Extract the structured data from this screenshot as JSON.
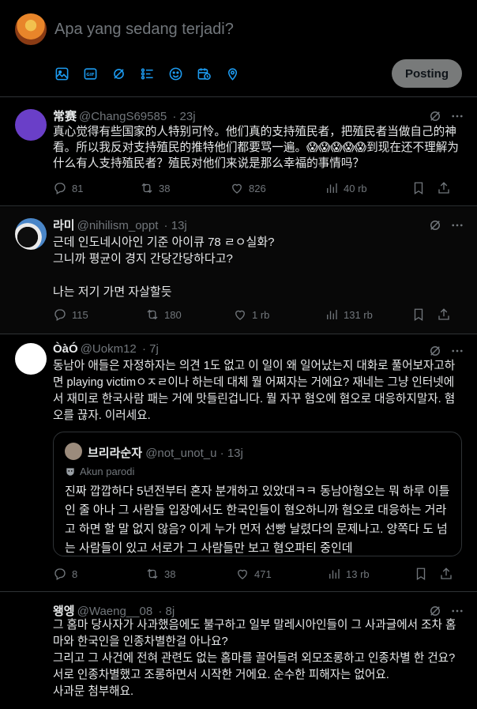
{
  "composer": {
    "placeholder": "Apa yang sedang terjadi?",
    "tools": [
      "image-icon",
      "gif-icon",
      "grok-icon",
      "poll-icon",
      "emoji-icon",
      "schedule-icon",
      "location-icon"
    ],
    "post_label": "Posting"
  },
  "tweets": [
    {
      "name": "常赛",
      "handle": "@ChangS69585",
      "time": "23j",
      "text": "真心觉得有些国家的人特别可怜。他们真的支持殖民者，把殖民者当做自己的神看。所以我反对支持殖民的推特他们都要骂一遍。😱😱😱😱😱到现在还不理解为什么有人支持殖民者？殖民对他们来说是那么幸福的事情吗？",
      "replies": "81",
      "reposts": "38",
      "likes": "826",
      "views": "40 rb"
    },
    {
      "name": "라미",
      "handle": "@nihilism_oppt",
      "time": "13j",
      "text": "근데 인도네시아인 기준 아이큐 78 ㄹㅇ실화?\n그니까 평균이 경지 간당간당하다고?\n\n나는 저기 가면 자살할듯",
      "replies": "115",
      "reposts": "180",
      "likes": "1 rb",
      "views": "131 rb"
    },
    {
      "name": "ÒàÓ",
      "handle": "@Uokm12",
      "time": "7j",
      "text": "동남아 애들은 자정하자는 의견 1도 없고 이 일이 왜 일어났는지 대화로 풀어보자고하면 playing victimㅇㅈㄹ이나 하는데 대체 뭘 어쩌자는 거에요? 재네는 그냥 인터넷에서 재미로 한국사람 패는 거에 맛들린겁니다. 뭘 자꾸 혐오에 혐오로 대응하지말자. 혐오를 끊자. 이러세요.",
      "quote": {
        "name": "브리라순자",
        "handle": "@not_unot_u",
        "time": "13j",
        "parody": "Akun parodi",
        "text": "진짜 깝깝하다 5년전부터 혼자 분개하고 있았대ㅋㅋ 동남아혐오는 뭐 하루 이틀인 줄 아나 그 사람들 입장에서도 한국인들이 혐오하니까 혐오로 대응하는 거라고 하면 할 말 없지 않음? 이게 누가 먼저 선빵 날렸다의 문제나고. 양쪽다 도 넘는 사람들이 있고 서로가 그 사람들만 보고 혐오파티 중인데"
      },
      "replies": "8",
      "reposts": "38",
      "likes": "471",
      "views": "13 rb"
    },
    {
      "name": "왱엥",
      "handle": "@Waeng__08",
      "time": "8j",
      "text": "그 홈마 당사자가 사과했음에도 불구하고 일부 말레시아인들이 그 사과글에서 조차 홈마와 한국인을 인종차별한걸 아나요?\n그리고 그 사건에 전혀 관련도 없는 홈마를 끌어들려 외모조롱하고 인종차별 한 건요?\n서로 인종차별했고 조롱하면서 시작한 거에요. 순수한 피해자는 없어요.\n사과문 첨부해요."
    }
  ]
}
